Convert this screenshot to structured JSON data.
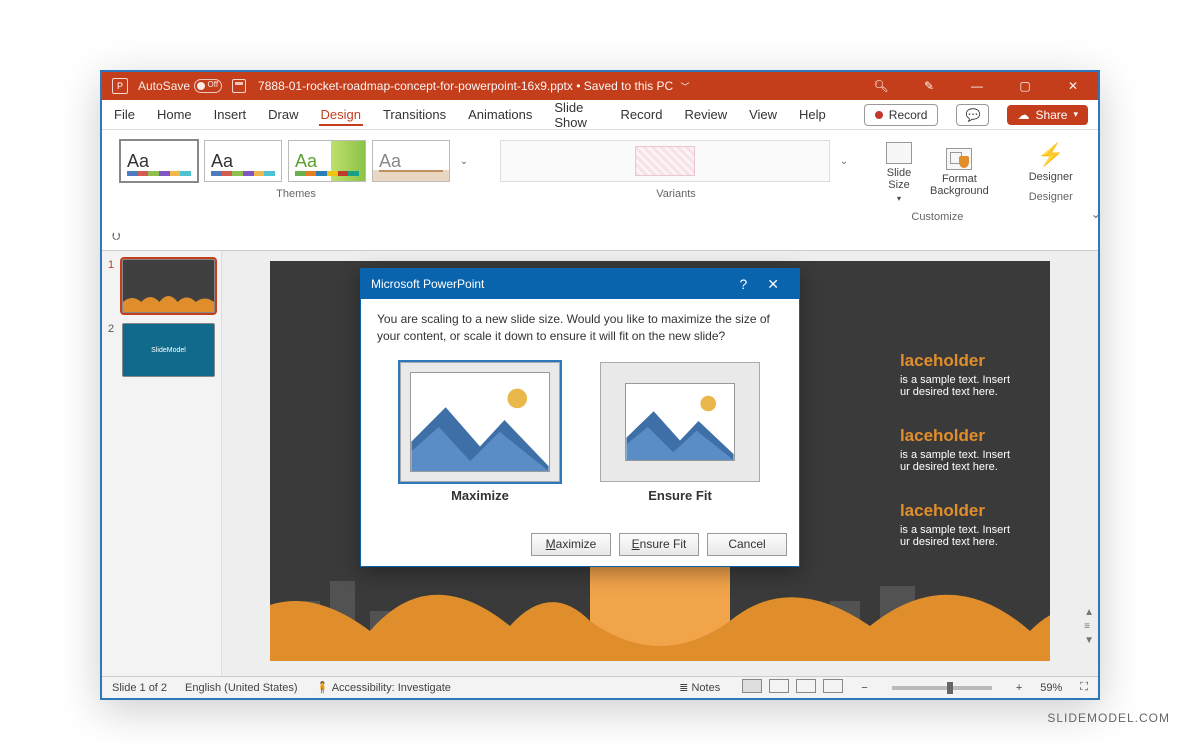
{
  "titlebar": {
    "autosave": "AutoSave",
    "autosave_state": "Off",
    "filename": "7888-01-rocket-roadmap-concept-for-powerpoint-16x9.pptx",
    "saved_status": "Saved to this PC"
  },
  "menu": {
    "file": "File",
    "home": "Home",
    "insert": "Insert",
    "draw": "Draw",
    "design": "Design",
    "transitions": "Transitions",
    "animations": "Animations",
    "slideshow": "Slide Show",
    "record": "Record",
    "review": "Review",
    "view": "View",
    "help": "Help",
    "record_btn": "Record",
    "share_btn": "Share"
  },
  "ribbon": {
    "themes_label": "Themes",
    "variants_label": "Variants",
    "customize_label": "Customize",
    "designer_label": "Designer",
    "slide_size": "Slide\nSize",
    "format_bg": "Format\nBackground",
    "designer": "Designer",
    "aa": "Aa"
  },
  "thumbs": {
    "n1": "1",
    "n2": "2",
    "logo": "SlideModel"
  },
  "slide": {
    "ph_title": "laceholder",
    "ph_line1": "is a sample text. Insert",
    "ph_line2": "ur desired text here."
  },
  "dialog": {
    "title": "Microsoft PowerPoint",
    "message": "You are scaling to a new slide size.  Would you like to maximize the size of your content, or scale it down to ensure it will fit on the new slide?",
    "opt_max": "Maximize",
    "opt_fit": "Ensure Fit",
    "btn_max_pre": "M",
    "btn_max_rest": "aximize",
    "btn_fit_pre": "E",
    "btn_fit_rest": "nsure Fit",
    "btn_cancel": "Cancel"
  },
  "status": {
    "slide": "Slide 1 of 2",
    "lang": "English (United States)",
    "a11y": "Accessibility: Investigate",
    "notes": "Notes",
    "zoom": "59%"
  },
  "watermark": "SLIDEMODEL.COM"
}
